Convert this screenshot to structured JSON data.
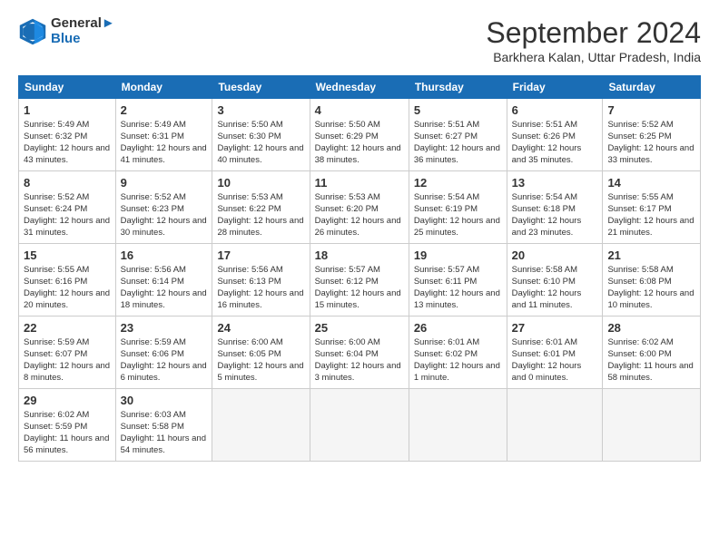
{
  "header": {
    "logo_line1": "General",
    "logo_line2": "Blue",
    "month": "September 2024",
    "location": "Barkhera Kalan, Uttar Pradesh, India"
  },
  "weekdays": [
    "Sunday",
    "Monday",
    "Tuesday",
    "Wednesday",
    "Thursday",
    "Friday",
    "Saturday"
  ],
  "weeks": [
    [
      {
        "day": "1",
        "info": "Sunrise: 5:49 AM\nSunset: 6:32 PM\nDaylight: 12 hours and 43 minutes."
      },
      {
        "day": "2",
        "info": "Sunrise: 5:49 AM\nSunset: 6:31 PM\nDaylight: 12 hours and 41 minutes."
      },
      {
        "day": "3",
        "info": "Sunrise: 5:50 AM\nSunset: 6:30 PM\nDaylight: 12 hours and 40 minutes."
      },
      {
        "day": "4",
        "info": "Sunrise: 5:50 AM\nSunset: 6:29 PM\nDaylight: 12 hours and 38 minutes."
      },
      {
        "day": "5",
        "info": "Sunrise: 5:51 AM\nSunset: 6:27 PM\nDaylight: 12 hours and 36 minutes."
      },
      {
        "day": "6",
        "info": "Sunrise: 5:51 AM\nSunset: 6:26 PM\nDaylight: 12 hours and 35 minutes."
      },
      {
        "day": "7",
        "info": "Sunrise: 5:52 AM\nSunset: 6:25 PM\nDaylight: 12 hours and 33 minutes."
      }
    ],
    [
      {
        "day": "8",
        "info": "Sunrise: 5:52 AM\nSunset: 6:24 PM\nDaylight: 12 hours and 31 minutes."
      },
      {
        "day": "9",
        "info": "Sunrise: 5:52 AM\nSunset: 6:23 PM\nDaylight: 12 hours and 30 minutes."
      },
      {
        "day": "10",
        "info": "Sunrise: 5:53 AM\nSunset: 6:22 PM\nDaylight: 12 hours and 28 minutes."
      },
      {
        "day": "11",
        "info": "Sunrise: 5:53 AM\nSunset: 6:20 PM\nDaylight: 12 hours and 26 minutes."
      },
      {
        "day": "12",
        "info": "Sunrise: 5:54 AM\nSunset: 6:19 PM\nDaylight: 12 hours and 25 minutes."
      },
      {
        "day": "13",
        "info": "Sunrise: 5:54 AM\nSunset: 6:18 PM\nDaylight: 12 hours and 23 minutes."
      },
      {
        "day": "14",
        "info": "Sunrise: 5:55 AM\nSunset: 6:17 PM\nDaylight: 12 hours and 21 minutes."
      }
    ],
    [
      {
        "day": "15",
        "info": "Sunrise: 5:55 AM\nSunset: 6:16 PM\nDaylight: 12 hours and 20 minutes."
      },
      {
        "day": "16",
        "info": "Sunrise: 5:56 AM\nSunset: 6:14 PM\nDaylight: 12 hours and 18 minutes."
      },
      {
        "day": "17",
        "info": "Sunrise: 5:56 AM\nSunset: 6:13 PM\nDaylight: 12 hours and 16 minutes."
      },
      {
        "day": "18",
        "info": "Sunrise: 5:57 AM\nSunset: 6:12 PM\nDaylight: 12 hours and 15 minutes."
      },
      {
        "day": "19",
        "info": "Sunrise: 5:57 AM\nSunset: 6:11 PM\nDaylight: 12 hours and 13 minutes."
      },
      {
        "day": "20",
        "info": "Sunrise: 5:58 AM\nSunset: 6:10 PM\nDaylight: 12 hours and 11 minutes."
      },
      {
        "day": "21",
        "info": "Sunrise: 5:58 AM\nSunset: 6:08 PM\nDaylight: 12 hours and 10 minutes."
      }
    ],
    [
      {
        "day": "22",
        "info": "Sunrise: 5:59 AM\nSunset: 6:07 PM\nDaylight: 12 hours and 8 minutes."
      },
      {
        "day": "23",
        "info": "Sunrise: 5:59 AM\nSunset: 6:06 PM\nDaylight: 12 hours and 6 minutes."
      },
      {
        "day": "24",
        "info": "Sunrise: 6:00 AM\nSunset: 6:05 PM\nDaylight: 12 hours and 5 minutes."
      },
      {
        "day": "25",
        "info": "Sunrise: 6:00 AM\nSunset: 6:04 PM\nDaylight: 12 hours and 3 minutes."
      },
      {
        "day": "26",
        "info": "Sunrise: 6:01 AM\nSunset: 6:02 PM\nDaylight: 12 hours and 1 minute."
      },
      {
        "day": "27",
        "info": "Sunrise: 6:01 AM\nSunset: 6:01 PM\nDaylight: 12 hours and 0 minutes."
      },
      {
        "day": "28",
        "info": "Sunrise: 6:02 AM\nSunset: 6:00 PM\nDaylight: 11 hours and 58 minutes."
      }
    ],
    [
      {
        "day": "29",
        "info": "Sunrise: 6:02 AM\nSunset: 5:59 PM\nDaylight: 11 hours and 56 minutes."
      },
      {
        "day": "30",
        "info": "Sunrise: 6:03 AM\nSunset: 5:58 PM\nDaylight: 11 hours and 54 minutes."
      },
      null,
      null,
      null,
      null,
      null
    ]
  ]
}
